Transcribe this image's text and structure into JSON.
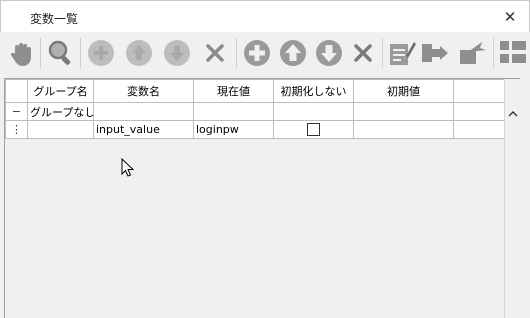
{
  "window": {
    "title": "変数一覧",
    "close_symbol": "✕"
  },
  "toolbar": {
    "items": [
      {
        "name": "hand-tool-icon"
      },
      {
        "name": "search-icon"
      },
      {
        "name": "remove-circle-icon"
      },
      {
        "name": "move-up-icon"
      },
      {
        "name": "move-down-icon"
      },
      {
        "name": "delete-x-icon"
      },
      {
        "name": "add-circle-icon"
      },
      {
        "name": "move-up-circle-icon"
      },
      {
        "name": "move-down-circle-icon"
      },
      {
        "name": "delete-x-icon-2"
      },
      {
        "name": "edit-document-icon"
      },
      {
        "name": "import-icon"
      },
      {
        "name": "export-icon"
      },
      {
        "name": "grid-icon"
      }
    ]
  },
  "table": {
    "columns": [
      "",
      "グループ名",
      "変数名",
      "現在値",
      "初期化しない",
      "初期値",
      ""
    ],
    "rows": [
      {
        "marker": "−",
        "group": "グループなし",
        "name": "",
        "value": "",
        "no_init": "",
        "initial": ""
      },
      {
        "marker": "⋮",
        "group": "",
        "name": "input_value",
        "value": "loginpw",
        "no_init": "checkbox",
        "initial": ""
      }
    ]
  }
}
